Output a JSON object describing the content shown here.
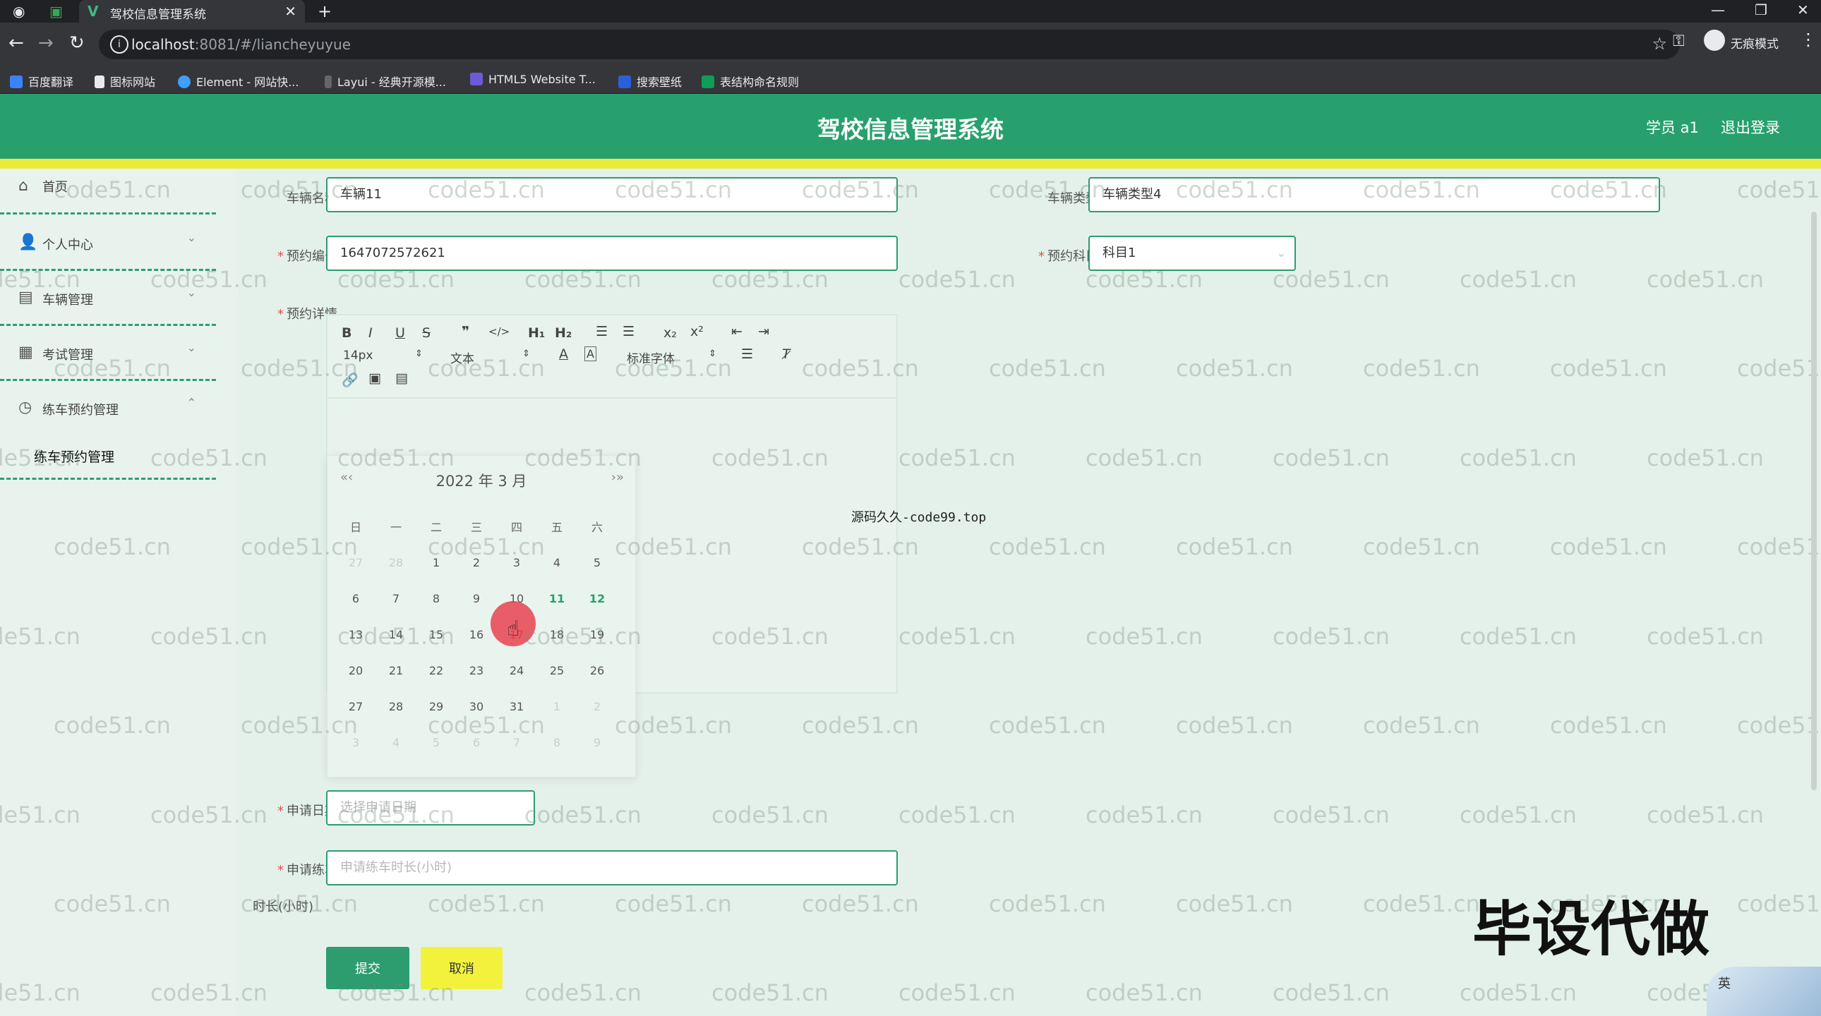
{
  "browser": {
    "tab_title": "驾校信息管理系统",
    "url_host": "localhost",
    "url_rest": ":8081/#/liancheyuyue",
    "incognito_label": "无痕模式",
    "bookmarks": [
      "百度翻译",
      "图标网站",
      "Element - 网站快...",
      "Layui - 经典开源模...",
      "HTML5 Website T...",
      "搜索壁纸",
      "表结构命名规则"
    ]
  },
  "header": {
    "title": "驾校信息管理系统",
    "user": "学员 a1",
    "logout": "退出登录"
  },
  "sidebar": {
    "items": [
      {
        "label": "首页",
        "icon": "home-icon",
        "glyph": "⌂",
        "arrow": ""
      },
      {
        "label": "个人中心",
        "icon": "user-icon",
        "glyph": "👤",
        "arrow": "⌄"
      },
      {
        "label": "车辆管理",
        "icon": "car-icon",
        "glyph": "▤",
        "arrow": "⌄"
      },
      {
        "label": "考试管理",
        "icon": "grid-icon",
        "glyph": "▦",
        "arrow": "⌄"
      },
      {
        "label": "练车预约管理",
        "icon": "clock-icon",
        "glyph": "◷",
        "arrow": "⌃"
      }
    ],
    "sub_item": "练车预约管理"
  },
  "form": {
    "vehicle_name_label": "车辆名称",
    "vehicle_name_value": "车辆11",
    "vehicle_type_label": "车辆类型",
    "vehicle_type_value": "车辆类型4",
    "booking_no_label": "预约编号",
    "booking_no_value": "1647072572621",
    "subject_label": "预约科目",
    "subject_value": "科目1",
    "detail_label": "预约详情",
    "apply_date_label": "申请日期",
    "apply_date_placeholder": "选择申请日期",
    "duration_label_1": "申请练车",
    "duration_label_2": "时长(小时)",
    "duration_placeholder": "申请练车时长(小时)",
    "submit": "提交",
    "cancel": "取消"
  },
  "editor": {
    "font_size": "14px",
    "text_type": "文本",
    "font_family": "标准字体"
  },
  "datepicker": {
    "title": "2022 年  3 月",
    "weekdays": [
      "日",
      "一",
      "二",
      "三",
      "四",
      "五",
      "六"
    ],
    "weeks": [
      [
        "27",
        "28",
        "1",
        "2",
        "3",
        "4",
        "5"
      ],
      [
        "6",
        "7",
        "8",
        "9",
        "10",
        "11",
        "12"
      ],
      [
        "13",
        "14",
        "15",
        "16",
        "17",
        "18",
        "19"
      ],
      [
        "20",
        "21",
        "22",
        "23",
        "24",
        "25",
        "26"
      ],
      [
        "27",
        "28",
        "29",
        "30",
        "31",
        "1",
        "2"
      ],
      [
        "3",
        "4",
        "5",
        "6",
        "7",
        "8",
        "9"
      ]
    ]
  },
  "overlay": {
    "watermark": "code51.cn",
    "source_note": "源码久久-code99.top",
    "promo": "毕设代做",
    "ime": "英"
  }
}
